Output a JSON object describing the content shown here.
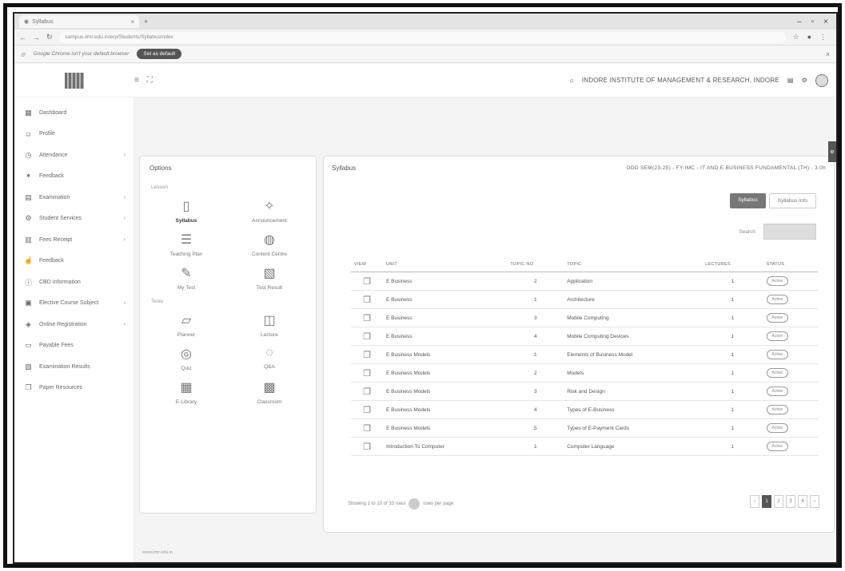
{
  "browser": {
    "tab_title": "Syllabus",
    "url": "campus.iimr.edu.in/erp/Students/SyllabusIndex",
    "infobar_text": "Google Chrome isn't your default browser",
    "set_default_label": "Set as default"
  },
  "header": {
    "institute": "INDORE INSTITUTE OF MANAGEMENT & RESEARCH, INDORE"
  },
  "sidebar": {
    "items": [
      {
        "label": "Dashboard",
        "icon": "grid-icon",
        "chevron": false
      },
      {
        "label": "Profile",
        "icon": "user-icon",
        "chevron": false
      },
      {
        "label": "Attendance",
        "icon": "clock-icon",
        "chevron": true
      },
      {
        "label": "Feedback",
        "icon": "star-icon",
        "chevron": false
      },
      {
        "label": "Examination",
        "icon": "file-icon",
        "chevron": true
      },
      {
        "label": "Student Services",
        "icon": "settings-icon",
        "chevron": true
      },
      {
        "label": "Fees Receipt",
        "icon": "receipt-icon",
        "chevron": true
      },
      {
        "label": "Feedback",
        "icon": "thumbs-icon",
        "chevron": false
      },
      {
        "label": "CBD Information",
        "icon": "info-icon",
        "chevron": false
      },
      {
        "label": "Elective Course Subject",
        "icon": "book-icon",
        "chevron": true
      },
      {
        "label": "Online Registration",
        "icon": "form-icon",
        "chevron": true
      },
      {
        "label": "Payable Fees",
        "icon": "wallet-icon",
        "chevron": false
      },
      {
        "label": "Examination Results",
        "icon": "result-icon",
        "chevron": false
      },
      {
        "label": "Paper Resources",
        "icon": "paper-icon",
        "chevron": false
      }
    ]
  },
  "options": {
    "title": "Options",
    "section1": "Lesson",
    "section2": "Tests",
    "group1": [
      {
        "label": "Syllabus",
        "icon": "document-icon",
        "active": true
      },
      {
        "label": "Announcement",
        "icon": "announce-icon",
        "active": false
      },
      {
        "label": "Teaching Plan",
        "icon": "list-icon",
        "active": false
      },
      {
        "label": "Content Centre",
        "icon": "globe-icon",
        "active": false
      },
      {
        "label": "My Test",
        "icon": "test-icon",
        "active": false
      },
      {
        "label": "Test Result",
        "icon": "result-icon",
        "active": false
      }
    ],
    "group2": [
      {
        "label": "Planner",
        "icon": "planner-icon",
        "active": false
      },
      {
        "label": "Lecture",
        "icon": "lecture-icon",
        "active": false
      },
      {
        "label": "Quiz",
        "icon": "quiz-icon",
        "active": false
      },
      {
        "label": "Q&A",
        "icon": "qa-icon",
        "active": false
      },
      {
        "label": "E-Library",
        "icon": "library-icon",
        "active": false
      },
      {
        "label": "Classroom",
        "icon": "classroom-icon",
        "active": false
      }
    ]
  },
  "syllabus": {
    "title": "Syllabus",
    "course": "ODD SEM(23-25) - FY-IMC - IT AND E BUSINESS FUNDAMENTAL (TH) - 3.0h",
    "btn_primary": "Syllabus",
    "btn_secondary": "Syllabus Info",
    "search_label": "Search",
    "columns": [
      "VIEW",
      "UNIT",
      "TOPIC NO",
      "TOPIC",
      "LECTURES",
      "STATUS"
    ],
    "rows": [
      {
        "unit": "E Business",
        "topic_no": "2",
        "topic": "Application",
        "lectures": "1",
        "status": "Active"
      },
      {
        "unit": "E Business",
        "topic_no": "1",
        "topic": "Architecture",
        "lectures": "1",
        "status": "Active"
      },
      {
        "unit": "E Business",
        "topic_no": "3",
        "topic": "Mobile Computing",
        "lectures": "1",
        "status": "Active"
      },
      {
        "unit": "E Business",
        "topic_no": "4",
        "topic": "Mobile Computing Devices",
        "lectures": "1",
        "status": "Active"
      },
      {
        "unit": "E Business Models",
        "topic_no": "1",
        "topic": "Elements of Business Model",
        "lectures": "1",
        "status": "Active"
      },
      {
        "unit": "E Business Models",
        "topic_no": "2",
        "topic": "Models",
        "lectures": "1",
        "status": "Active"
      },
      {
        "unit": "E Business Models",
        "topic_no": "3",
        "topic": "Risk and Design",
        "lectures": "1",
        "status": "Active"
      },
      {
        "unit": "E Business Models",
        "topic_no": "4",
        "topic": "Types of E-Business",
        "lectures": "1",
        "status": "Active"
      },
      {
        "unit": "E Business Models",
        "topic_no": "5",
        "topic": "Types of E-Payment Cards",
        "lectures": "1",
        "status": "Active"
      },
      {
        "unit": "Introduction To Computer",
        "topic_no": "1",
        "topic": "Computer Language",
        "lectures": "1",
        "status": "Active"
      }
    ],
    "footer_text": "Showing 1 to 10 of 33 rows",
    "per_page_label": "rows per page",
    "pages": [
      "‹",
      "1",
      "2",
      "3",
      "4",
      "›"
    ],
    "active_page": "1"
  },
  "page_footer": "www.iimr.edu.in"
}
